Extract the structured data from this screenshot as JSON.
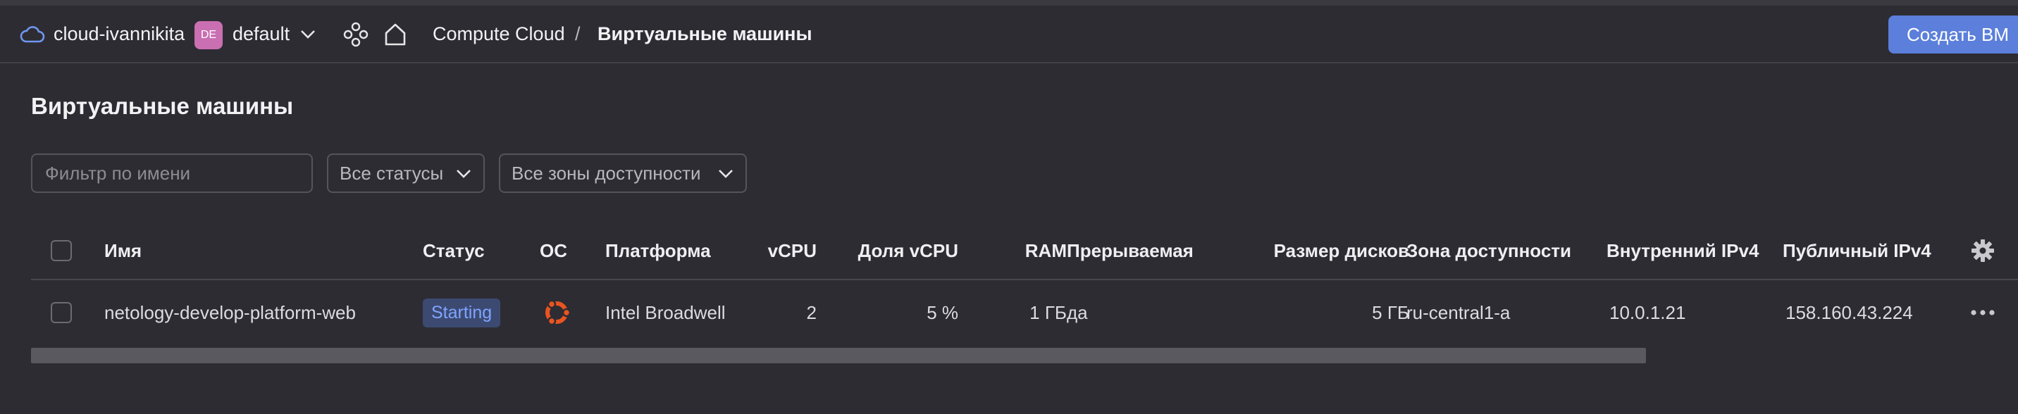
{
  "header": {
    "cloud_name": "cloud-ivannikita",
    "folder_badge": "DE",
    "folder_name": "default",
    "breadcrumb_service": "Compute Cloud",
    "breadcrumb_separator": "/",
    "breadcrumb_current": "Виртуальные машины",
    "create_button": "Создать ВМ"
  },
  "page": {
    "title": "Виртуальные машины",
    "filter_placeholder": "Фильтр по имени",
    "status_filter": "Все статусы",
    "zone_filter": "Все зоны доступности"
  },
  "table": {
    "columns": {
      "name": "Имя",
      "status": "Статус",
      "os": "ОС",
      "platform": "Платформа",
      "vcpu": "vCPU",
      "vcpu_share": "Доля vCPU",
      "ram": "RAM",
      "preemptible": "Прерываемая",
      "disk_size": "Размер дисков",
      "zone": "Зона доступности",
      "internal_ip": "Внутренний IPv4",
      "public_ip": "Публичный IPv4"
    },
    "rows": [
      {
        "name": "netology-develop-platform-web",
        "status": "Starting",
        "os_icon": "ubuntu-icon",
        "platform": "Intel Broadwell",
        "vcpu": "2",
        "vcpu_share": "5 %",
        "ram": "1 ГБ",
        "preemptible": "да",
        "disk_size": "5 ГБ",
        "zone": "ru-central1-a",
        "internal_ip": "10.0.1.21",
        "public_ip": "158.160.43.224"
      }
    ]
  },
  "colors": {
    "background": "#2d2c33",
    "accent": "#5b7fda",
    "status_badge_bg": "#3c4a72",
    "status_badge_text": "#7fa4ff",
    "ubuntu": "#e95420",
    "folder_badge": "#c96fb2"
  },
  "icons": [
    "cloud-icon",
    "chevron-down-icon",
    "services-icon",
    "home-icon",
    "ubuntu-icon",
    "gear-icon",
    "more-icon"
  ]
}
